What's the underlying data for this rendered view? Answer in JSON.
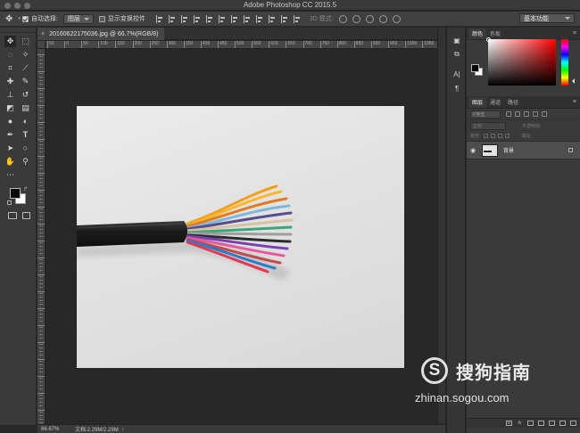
{
  "app": {
    "title": "Adobe Photoshop CC 2015.5"
  },
  "options_bar": {
    "tool_icon": "move-tool-icon",
    "auto_select_label": "自动选择:",
    "auto_select_target": "图层",
    "show_transform_label": "显示变换控件",
    "mode_3d_label": "3D 模式:",
    "workspace": "基本功能"
  },
  "document": {
    "tab_label": "20160622175036.jpg @ 66.7%(RGB/8)",
    "close_glyph": "×"
  },
  "ruler": {
    "h_ticks": [
      "50",
      "0",
      "50",
      "100",
      "150",
      "200",
      "250",
      "300",
      "350",
      "400",
      "450",
      "500",
      "550",
      "600",
      "650",
      "700",
      "750",
      "800",
      "850",
      "900",
      "950",
      "1000",
      "1050"
    ]
  },
  "status": {
    "zoom": "66.67%",
    "doc_size": "文档:2.29M/2.29M",
    "arrow": "›"
  },
  "color_panel": {
    "tabs": [
      "颜色",
      "色板"
    ],
    "active_tab": 0,
    "fg_color": "#080808",
    "bg_color": "#ffffff",
    "hue_color": "#ff0000"
  },
  "layers_panel": {
    "tabs": [
      "图层",
      "通道",
      "路径"
    ],
    "active_tab": 0,
    "filter_kind": "P类型",
    "blend_mode": "正常",
    "opacity_label": "不透明度:",
    "lock_label": "锁定:",
    "fill_label": "填充:",
    "layers": [
      {
        "name": "背景",
        "visible": true,
        "locked": true
      }
    ],
    "footer_fx": "fx"
  },
  "watermark": {
    "logo": "S",
    "brand": "搜狗指南",
    "url": "zhinan.sogou.com"
  }
}
